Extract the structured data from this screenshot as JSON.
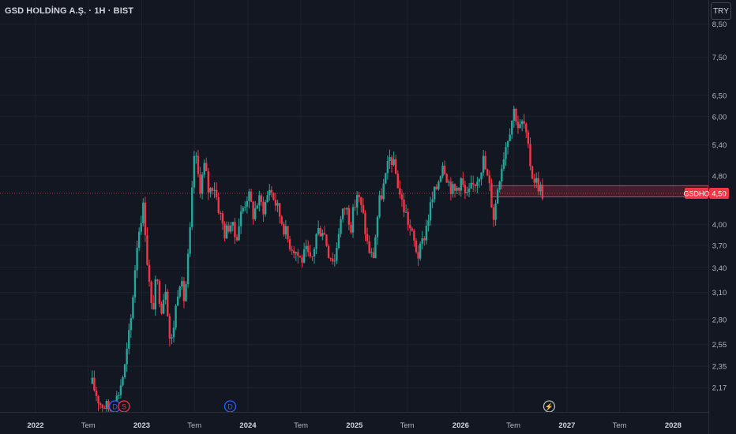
{
  "header": {
    "symbol_title": "GSD HOLDİNG A.Ş. · 1H · BIST",
    "currency_button": "TRY"
  },
  "price_label": {
    "ticker": "GSDHO",
    "value": "4,50"
  },
  "colors": {
    "background": "#131722",
    "up": "#26a69a",
    "down": "#f23645",
    "grid": "#1e222d",
    "axis_text": "#b2b5be"
  },
  "markers": [
    {
      "letter": "D",
      "type": "dividend",
      "color": "#2962ff",
      "date": "2022-10"
    },
    {
      "letter": "S",
      "type": "split",
      "color": "#f23645",
      "date": "2022-11"
    },
    {
      "letter": "D",
      "type": "dividend",
      "color": "#2962ff",
      "date": "2023-11"
    },
    {
      "letter": "⚡",
      "type": "event",
      "color": "#b2b5be",
      "date": "2026-11"
    }
  ],
  "chart_data": {
    "type": "candlestick",
    "interval": "weekly",
    "y_scale": "log",
    "ylim": [
      1.98,
      9.3
    ],
    "y_ticks": [
      "8,50",
      "7,50",
      "6,50",
      "6,00",
      "5,40",
      "4,80",
      "4,00",
      "3,70",
      "3,40",
      "3,10",
      "2,80",
      "2,55",
      "2,35",
      "2,17"
    ],
    "y_tick_values": [
      8.5,
      7.5,
      6.5,
      6.0,
      5.4,
      4.8,
      4.0,
      3.7,
      3.4,
      3.1,
      2.8,
      2.55,
      2.35,
      2.17
    ],
    "x_range": [
      "2021-09",
      "2028-05"
    ],
    "x_ticks": [
      {
        "label": "2022",
        "date": "2022-01",
        "major": true
      },
      {
        "label": "Tem",
        "date": "2022-07",
        "major": false
      },
      {
        "label": "2023",
        "date": "2023-01",
        "major": true
      },
      {
        "label": "Tem",
        "date": "2023-07",
        "major": false
      },
      {
        "label": "2024",
        "date": "2024-01",
        "major": true
      },
      {
        "label": "Tem",
        "date": "2024-07",
        "major": false
      },
      {
        "label": "2025",
        "date": "2025-01",
        "major": true
      },
      {
        "label": "Tem",
        "date": "2025-07",
        "major": false
      },
      {
        "label": "2026",
        "date": "2026-01",
        "major": true
      },
      {
        "label": "Tem",
        "date": "2026-07",
        "major": false
      },
      {
        "label": "2027",
        "date": "2027-01",
        "major": true
      },
      {
        "label": "Tem",
        "date": "2027-07",
        "major": false
      },
      {
        "label": "2028",
        "date": "2028-01",
        "major": true
      }
    ],
    "price_path": [
      [
        "2022-07-15",
        2.2
      ],
      [
        "2022-08-10",
        2.05
      ],
      [
        "2022-09-15",
        2.0
      ],
      [
        "2022-10-10",
        2.1
      ],
      [
        "2022-11-05",
        2.35
      ],
      [
        "2022-11-25",
        2.8
      ],
      [
        "2022-12-15",
        3.7
      ],
      [
        "2022-12-28",
        4.1
      ],
      [
        "2023-01-08",
        4.3
      ],
      [
        "2023-01-20",
        3.5
      ],
      [
        "2023-02-05",
        2.85
      ],
      [
        "2023-02-20",
        3.25
      ],
      [
        "2023-03-10",
        2.95
      ],
      [
        "2023-03-25",
        3.2
      ],
      [
        "2023-04-10",
        2.5
      ],
      [
        "2023-04-25",
        2.85
      ],
      [
        "2023-05-10",
        3.3
      ],
      [
        "2023-05-28",
        3.0
      ],
      [
        "2023-06-15",
        3.8
      ],
      [
        "2023-07-01",
        5.3
      ],
      [
        "2023-07-20",
        4.6
      ],
      [
        "2023-08-05",
        5.0
      ],
      [
        "2023-08-20",
        4.5
      ],
      [
        "2023-09-05",
        4.7
      ],
      [
        "2023-09-25",
        4.2
      ],
      [
        "2023-10-15",
        3.85
      ],
      [
        "2023-11-01",
        4.05
      ],
      [
        "2023-11-20",
        3.8
      ],
      [
        "2023-12-10",
        4.2
      ],
      [
        "2024-01-01",
        4.5
      ],
      [
        "2024-01-20",
        4.15
      ],
      [
        "2024-02-05",
        4.4
      ],
      [
        "2024-02-25",
        4.25
      ],
      [
        "2024-03-15",
        4.6
      ],
      [
        "2024-04-01",
        4.4
      ],
      [
        "2024-04-15",
        4.2
      ],
      [
        "2024-05-01",
        4.0
      ],
      [
        "2024-05-20",
        3.75
      ],
      [
        "2024-06-10",
        3.65
      ],
      [
        "2024-07-01",
        3.5
      ],
      [
        "2024-07-20",
        3.6
      ],
      [
        "2024-08-05",
        3.45
      ],
      [
        "2024-08-25",
        3.9
      ],
      [
        "2024-09-15",
        3.95
      ],
      [
        "2024-10-05",
        3.6
      ],
      [
        "2024-10-25",
        3.5
      ],
      [
        "2024-11-10",
        4.0
      ],
      [
        "2024-12-01",
        4.3
      ],
      [
        "2024-12-20",
        4.0
      ],
      [
        "2025-01-10",
        4.5
      ],
      [
        "2025-01-30",
        4.15
      ],
      [
        "2025-02-15",
        3.7
      ],
      [
        "2025-03-05",
        3.5
      ],
      [
        "2025-03-25",
        4.3
      ],
      [
        "2025-04-15",
        4.7
      ],
      [
        "2025-05-05",
        5.2
      ],
      [
        "2025-05-25",
        4.8
      ],
      [
        "2025-06-10",
        4.4
      ],
      [
        "2025-07-01",
        4.1
      ],
      [
        "2025-07-20",
        3.8
      ],
      [
        "2025-08-10",
        3.55
      ],
      [
        "2025-09-01",
        3.9
      ],
      [
        "2025-09-20",
        4.3
      ],
      [
        "2025-10-10",
        4.6
      ],
      [
        "2025-11-01",
        5.1
      ],
      [
        "2025-11-20",
        4.7
      ],
      [
        "2025-12-10",
        4.5
      ],
      [
        "2026-01-01",
        4.75
      ],
      [
        "2026-01-20",
        4.4
      ],
      [
        "2026-02-10",
        4.6
      ],
      [
        "2026-03-01",
        4.8
      ],
      [
        "2026-03-20",
        5.1
      ],
      [
        "2026-04-10",
        4.6
      ],
      [
        "2026-04-25",
        4.1
      ],
      [
        "2026-05-10",
        4.7
      ],
      [
        "2026-06-01",
        5.3
      ],
      [
        "2026-06-20",
        5.8
      ],
      [
        "2026-07-05",
        6.2
      ],
      [
        "2026-07-20",
        5.7
      ],
      [
        "2026-08-05",
        5.9
      ],
      [
        "2026-08-20",
        5.3
      ],
      [
        "2026-09-05",
        4.8
      ],
      [
        "2026-09-25",
        4.65
      ],
      [
        "2026-10-10",
        4.5
      ]
    ],
    "current_price": 4.5,
    "support_zone": {
      "from_date": "2026-04-15",
      "to_date": "2028-05-01",
      "low": 4.44,
      "high": 4.63
    }
  }
}
